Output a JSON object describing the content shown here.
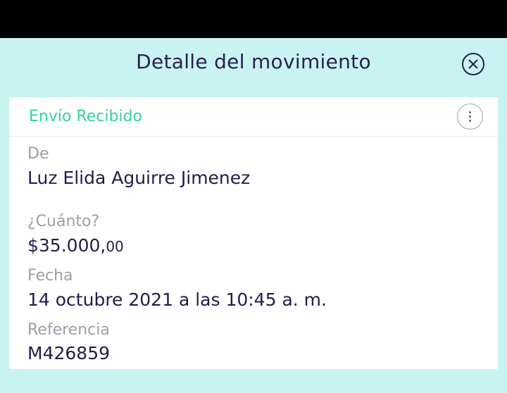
{
  "modal": {
    "title": "Detalle del movimiento"
  },
  "card": {
    "header_title": "Envío Recibido",
    "fields": {
      "from": {
        "label": "De",
        "value": "Luz Elida Aguirre Jimenez"
      },
      "amount": {
        "label": "¿Cuánto?",
        "main": "$35.000,",
        "cents": "00"
      },
      "date": {
        "label": "Fecha",
        "value": "14 octubre 2021 a las 10:45 a. m."
      },
      "reference": {
        "label": "Referencia",
        "value": "M426859"
      }
    }
  },
  "icons": {
    "close": "close-icon",
    "more": "more-vertical-icon"
  },
  "colors": {
    "background": "#c8f3f1",
    "accent_green": "#35d196",
    "text_dark": "#251b4a",
    "label_gray": "#9aa0a6"
  }
}
